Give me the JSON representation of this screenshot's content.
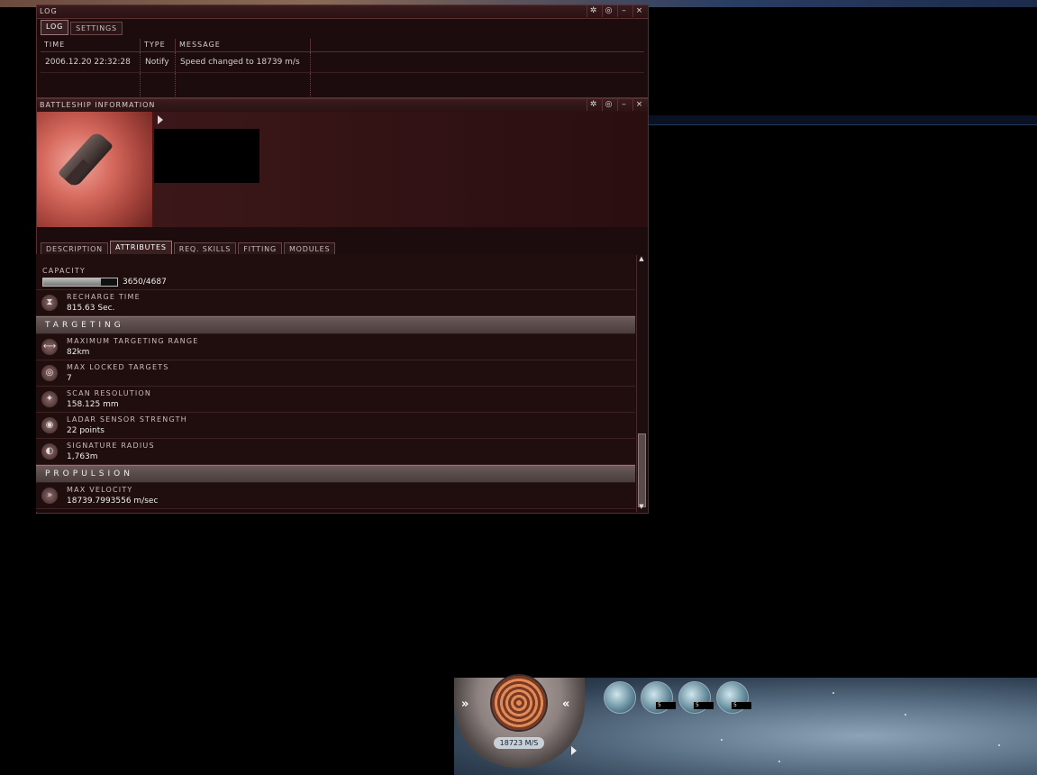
{
  "log_window": {
    "title": "LOG",
    "tabs": [
      "LOG",
      "SETTINGS"
    ],
    "columns": [
      "TIME",
      "TYPE",
      "MESSAGE"
    ],
    "rows": [
      {
        "time": "2006.12.20 22:32:28",
        "type": "Notify",
        "message": "Speed changed to 18739 m/s"
      }
    ]
  },
  "info_window": {
    "title": "BATTLESHIP INFORMATION",
    "tabs": [
      "DESCRIPTION",
      "ATTRIBUTES",
      "REQ. SKILLS",
      "FITTING",
      "MODULES"
    ],
    "active_tab": "ATTRIBUTES",
    "capacity": {
      "label": "CAPACITY",
      "value": "3650/4687",
      "fraction": 0.78
    },
    "recharge": {
      "label": "RECHARGE TIME",
      "value": "815.63 Sec."
    },
    "sections": [
      {
        "title": "TARGETING",
        "items": [
          {
            "icon": "targeting-range-icon",
            "glyph": "⟷",
            "label": "MAXIMUM TARGETING RANGE",
            "value": "82km"
          },
          {
            "icon": "locked-targets-icon",
            "glyph": "◎",
            "label": "MAX LOCKED TARGETS",
            "value": "7"
          },
          {
            "icon": "scan-resolution-icon",
            "glyph": "✦",
            "label": "SCAN RESOLUTION",
            "value": "158.125 mm"
          },
          {
            "icon": "ladar-sensor-icon",
            "glyph": "◉",
            "label": "LADAR SENSOR STRENGTH",
            "value": "22 points"
          },
          {
            "icon": "signature-radius-icon",
            "glyph": "◐",
            "label": "SIGNATURE RADIUS",
            "value": "1,763m"
          }
        ]
      },
      {
        "title": "PROPULSION",
        "items": [
          {
            "icon": "velocity-icon",
            "glyph": "»",
            "label": "MAX VELOCITY",
            "value": "18739.7993556 m/sec"
          }
        ]
      }
    ]
  },
  "hud": {
    "speed": "18723 M/S",
    "module_counts": [
      "5",
      "5",
      "5"
    ]
  }
}
